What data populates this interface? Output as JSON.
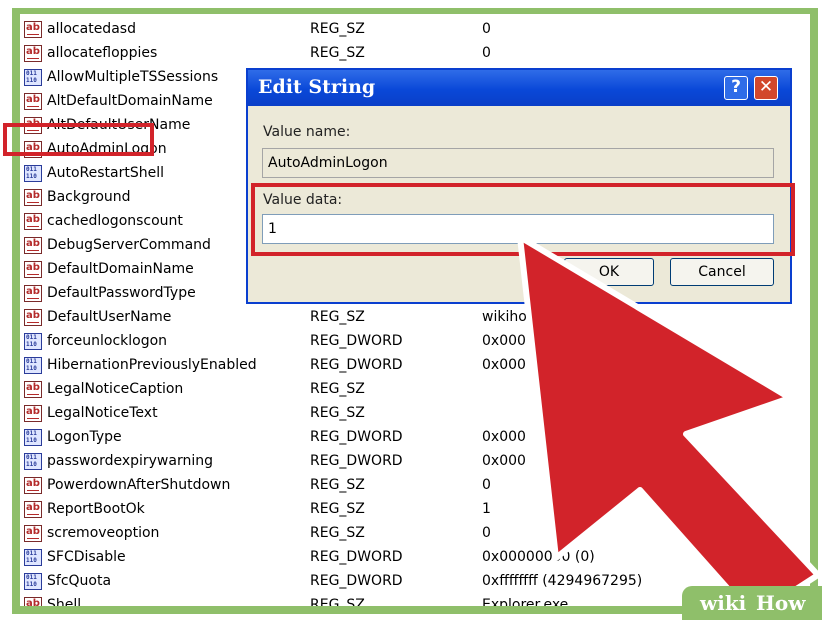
{
  "registry": {
    "rows": [
      {
        "icon": "sz",
        "name": "allocatedasd",
        "type": "REG_SZ",
        "data": "0"
      },
      {
        "icon": "sz",
        "name": "allocatefloppies",
        "type": "REG_SZ",
        "data": "0"
      },
      {
        "icon": "dw",
        "name": "AllowMultipleTSSessions",
        "type": "",
        "data": ""
      },
      {
        "icon": "sz",
        "name": "AltDefaultDomainName",
        "type": "",
        "data": ""
      },
      {
        "icon": "sz",
        "name": "AltDefaultUserName",
        "type": "",
        "data": ""
      },
      {
        "icon": "sz",
        "name": "AutoAdminLogon",
        "type": "",
        "data": ""
      },
      {
        "icon": "dw",
        "name": "AutoRestartShell",
        "type": "",
        "data": ""
      },
      {
        "icon": "sz",
        "name": "Background",
        "type": "",
        "data": ""
      },
      {
        "icon": "sz",
        "name": "cachedlogonscount",
        "type": "",
        "data": ""
      },
      {
        "icon": "sz",
        "name": "DebugServerCommand",
        "type": "",
        "data": ""
      },
      {
        "icon": "sz",
        "name": "DefaultDomainName",
        "type": "",
        "data": ""
      },
      {
        "icon": "sz",
        "name": "DefaultPasswordType",
        "type": "",
        "data": ""
      },
      {
        "icon": "sz",
        "name": "DefaultUserName",
        "type": "REG_SZ",
        "data": "wikiho"
      },
      {
        "icon": "dw",
        "name": "forceunlocklogon",
        "type": "REG_DWORD",
        "data": "0x000"
      },
      {
        "icon": "dw",
        "name": "HibernationPreviouslyEnabled",
        "type": "REG_DWORD",
        "data": "0x000"
      },
      {
        "icon": "sz",
        "name": "LegalNoticeCaption",
        "type": "REG_SZ",
        "data": ""
      },
      {
        "icon": "sz",
        "name": "LegalNoticeText",
        "type": "REG_SZ",
        "data": ""
      },
      {
        "icon": "dw",
        "name": "LogonType",
        "type": "REG_DWORD",
        "data": "0x000"
      },
      {
        "icon": "dw",
        "name": "passwordexpirywarning",
        "type": "REG_DWORD",
        "data": "0x000"
      },
      {
        "icon": "sz",
        "name": "PowerdownAfterShutdown",
        "type": "REG_SZ",
        "data": "0"
      },
      {
        "icon": "sz",
        "name": "ReportBootOk",
        "type": "REG_SZ",
        "data": "1"
      },
      {
        "icon": "sz",
        "name": "scremoveoption",
        "type": "REG_SZ",
        "data": "0"
      },
      {
        "icon": "dw",
        "name": "SFCDisable",
        "type": "REG_DWORD",
        "data": "0x00000000 (0)"
      },
      {
        "icon": "dw",
        "name": "SfcQuota",
        "type": "REG_DWORD",
        "data": "0xffffffff (4294967295)"
      },
      {
        "icon": "sz",
        "name": "Shell",
        "type": "REG_SZ",
        "data": "Explorer.exe"
      }
    ]
  },
  "dialog": {
    "title": "Edit String",
    "help_glyph": "?",
    "close_glyph": "✕",
    "value_name_label": "Value name:",
    "value_name": "AutoAdminLogon",
    "value_data_label": "Value data:",
    "value_data": "1",
    "ok_label": "OK",
    "cancel_label": "Cancel"
  },
  "icons": {
    "sz_glyph": "ab",
    "dw_glyph": "011 110"
  },
  "watermark": {
    "part1": "wiki",
    "part2": "How"
  },
  "colors": {
    "highlight": "#d2232a",
    "arrow": "#d2232a",
    "titlebar": "#0a48d8",
    "frame": "#8fbf6a"
  }
}
